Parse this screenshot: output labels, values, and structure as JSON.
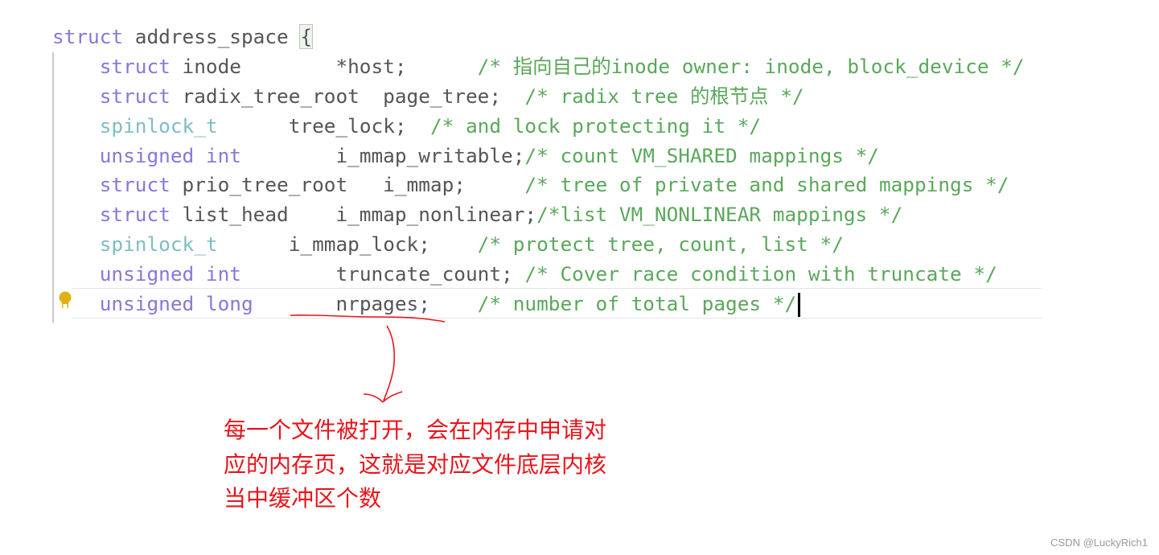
{
  "editor": {
    "lines": [
      [
        {
          "t": "kw",
          "s": "struct"
        },
        {
          "t": "id",
          "s": " address_space "
        },
        {
          "t": "brace",
          "s": "{"
        }
      ],
      [
        {
          "t": "id",
          "s": "    "
        },
        {
          "t": "kw",
          "s": "struct"
        },
        {
          "t": "id",
          "s": " inode        *host;      "
        },
        {
          "t": "cm",
          "s": "/* 指向自己的inode owner: inode, block_device */"
        }
      ],
      [
        {
          "t": "id",
          "s": "    "
        },
        {
          "t": "kw",
          "s": "struct"
        },
        {
          "t": "id",
          "s": " radix_tree_root  page_tree;  "
        },
        {
          "t": "cm",
          "s": "/* radix tree 的根节点 */"
        }
      ],
      [
        {
          "t": "id",
          "s": "    "
        },
        {
          "t": "ty",
          "s": "spinlock_t"
        },
        {
          "t": "id",
          "s": "      tree_lock;  "
        },
        {
          "t": "cm",
          "s": "/* and lock protecting it */"
        }
      ],
      [
        {
          "t": "id",
          "s": "    "
        },
        {
          "t": "kw",
          "s": "unsigned int"
        },
        {
          "t": "id",
          "s": "        i_mmap_writable;"
        },
        {
          "t": "cm",
          "s": "/* count VM_SHARED mappings */"
        }
      ],
      [
        {
          "t": "id",
          "s": "    "
        },
        {
          "t": "kw",
          "s": "struct"
        },
        {
          "t": "id",
          "s": " prio_tree_root   i_mmap;     "
        },
        {
          "t": "cm",
          "s": "/* tree of private and shared mappings */"
        }
      ],
      [
        {
          "t": "id",
          "s": "    "
        },
        {
          "t": "kw",
          "s": "struct"
        },
        {
          "t": "id",
          "s": " list_head    i_mmap_nonlinear;"
        },
        {
          "t": "cm",
          "s": "/*list VM_NONLINEAR mappings */"
        }
      ],
      [
        {
          "t": "id",
          "s": "    "
        },
        {
          "t": "ty",
          "s": "spinlock_t"
        },
        {
          "t": "id",
          "s": "      i_mmap_lock;    "
        },
        {
          "t": "cm",
          "s": "/* protect tree, count, list */"
        }
      ],
      [
        {
          "t": "id",
          "s": "    "
        },
        {
          "t": "kw",
          "s": "unsigned int"
        },
        {
          "t": "id",
          "s": "        truncate_count; "
        },
        {
          "t": "cm",
          "s": "/* Cover race condition with truncate */"
        }
      ],
      [
        {
          "t": "id",
          "s": "    "
        },
        {
          "t": "kw",
          "s": "unsigned long"
        },
        {
          "t": "id",
          "s": "       nrpages;    "
        },
        {
          "t": "cm",
          "s": "/* number of total pages */"
        }
      ]
    ],
    "lightbulb_icon": "lightbulb-icon",
    "colors": {
      "keyword": "#8379dc",
      "type": "#7fbcc4",
      "identifier": "#555555",
      "comment": "#5aa85a"
    }
  },
  "annotation": {
    "lines": [
      "每一个文件被打开，会在内存中申请对",
      "应的内存页，这就是对应文件底层内核",
      "当中缓冲区个数"
    ],
    "color": "#e8141a"
  },
  "watermark": "CSDN @LuckyRich1"
}
